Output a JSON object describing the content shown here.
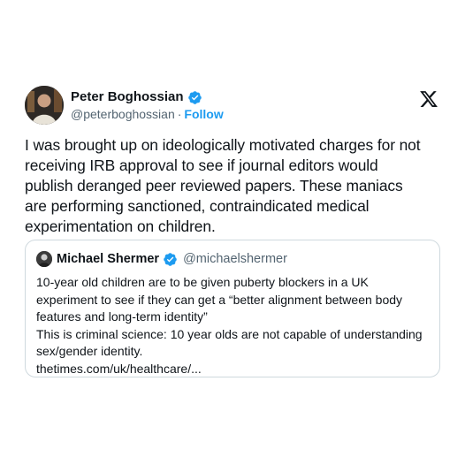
{
  "tweet": {
    "author": {
      "name": "Peter Boghossian",
      "handle": "@peterboghossian",
      "separator": "·",
      "follow_label": "Follow"
    },
    "text_lines": [
      "I was brought up on ideologically motivated charges for not",
      "receiving IRB approval to see if journal editors would",
      "publish deranged peer reviewed papers. These maniacs",
      "are performing sanctioned, contraindicated medical",
      "experimentation on children."
    ],
    "quoted": {
      "name": "Michael Shermer",
      "handle": "@michaelshermer",
      "text_lines": [
        "10-year old children are to be given puberty blockers in a UK",
        "experiment to see if they can get a “better alignment between body",
        "features and long-term identity”",
        "This is criminal science: 10 year olds are not capable of understanding",
        "sex/gender identity.",
        "thetimes.com/uk/healthcare/..."
      ]
    }
  },
  "icons": {
    "verified": "verified-badge-icon",
    "platform": "x-logo-icon"
  },
  "colors": {
    "link": "#1d9bf0",
    "text": "#0f1419",
    "secondary": "#536471",
    "border": "#cfd9de"
  }
}
